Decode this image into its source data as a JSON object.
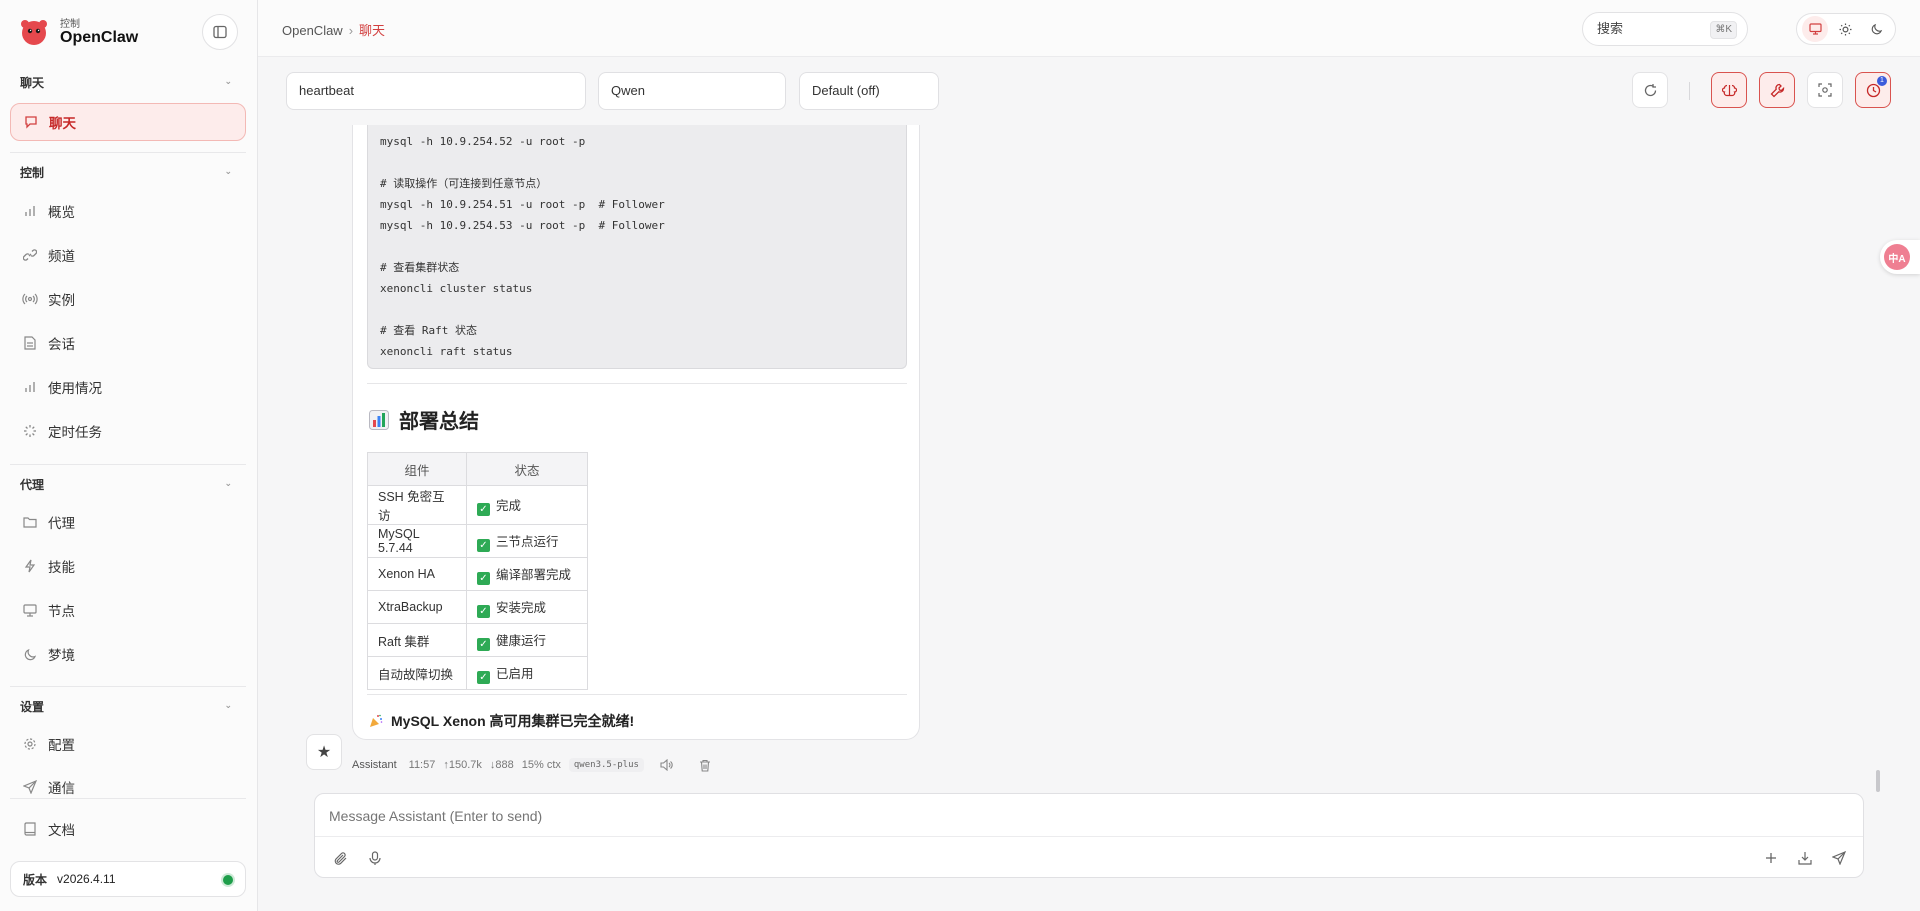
{
  "brand": {
    "small": "控制",
    "name": "OpenClaw"
  },
  "sidebar": {
    "sections": [
      {
        "label": "聊天"
      },
      {
        "label": "控制"
      },
      {
        "label": "代理"
      },
      {
        "label": "设置"
      }
    ],
    "items": [
      {
        "label": "聊天",
        "icon": "chat-icon"
      },
      {
        "label": "概览",
        "icon": "bar-chart-icon"
      },
      {
        "label": "频道",
        "icon": "link-icon"
      },
      {
        "label": "实例",
        "icon": "radio-icon"
      },
      {
        "label": "会话",
        "icon": "document-icon"
      },
      {
        "label": "使用情况",
        "icon": "bar-chart-icon"
      },
      {
        "label": "定时任务",
        "icon": "loader-icon"
      },
      {
        "label": "代理",
        "icon": "folder-icon"
      },
      {
        "label": "技能",
        "icon": "lightning-icon"
      },
      {
        "label": "节点",
        "icon": "monitor-icon"
      },
      {
        "label": "梦境",
        "icon": "moon-icon"
      },
      {
        "label": "配置",
        "icon": "gear-icon"
      },
      {
        "label": "通信",
        "icon": "send-icon"
      },
      {
        "label": "文档",
        "icon": "book-icon"
      }
    ],
    "version_label": "版本",
    "version_value": "v2026.4.11"
  },
  "header": {
    "breadcrumb_root": "OpenClaw",
    "breadcrumb_current": "聊天",
    "search_label": "搜索",
    "search_shortcut": "⌘K"
  },
  "toolbar": {
    "session": "heartbeat",
    "model": "Qwen",
    "thinking": "Default (off)"
  },
  "message": {
    "code_lines": [
      "mysql -h 10.9.254.52 -u root -p",
      "",
      "# 读取操作（可连接到任意节点）",
      "mysql -h 10.9.254.51 -u root -p  # Follower",
      "mysql -h 10.9.254.53 -u root -p  # Follower",
      "",
      "# 查看集群状态",
      "xenoncli cluster status",
      "",
      "# 查看 Raft 状态",
      "xenoncli raft status"
    ],
    "summary_title": "部署总结",
    "table": {
      "headers": [
        "组件",
        "状态"
      ],
      "rows": [
        [
          "SSH 免密互访",
          "完成"
        ],
        [
          "MySQL 5.7.44",
          "三节点运行"
        ],
        [
          "Xenon HA",
          "编译部署完成"
        ],
        [
          "XtraBackup",
          "安装完成"
        ],
        [
          "Raft 集群",
          "健康运行"
        ],
        [
          "自动故障切换",
          "已启用"
        ]
      ]
    },
    "final": "MySQL Xenon 高可用集群已完全就绪!",
    "meta": {
      "sender": "Assistant",
      "time": "11:57",
      "up": "↑150.7k",
      "down": "↓888",
      "ctx": "15% ctx",
      "model": "qwen3.5-plus"
    }
  },
  "composer": {
    "placeholder": "Message Assistant (Enter to send)"
  },
  "colors": {
    "accent": "#d23f3f",
    "success": "#2eaa55",
    "status_online": "#1e9e4a"
  }
}
